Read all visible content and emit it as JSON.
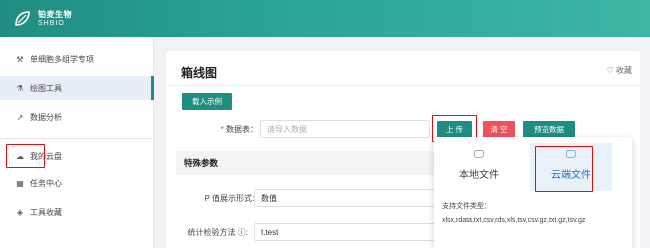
{
  "brand": {
    "name_cn": "铂麦生物",
    "name_en": "SHBIO"
  },
  "sidebar": {
    "items": [
      {
        "label": "单细胞多组学专项",
        "icon": "wrench-icon"
      },
      {
        "label": "绘图工具",
        "icon": "flask-icon"
      },
      {
        "label": "数据分析",
        "icon": "line-chart-icon"
      },
      {
        "label": "我的云盘",
        "icon": "cloud-icon"
      },
      {
        "label": "任务中心",
        "icon": "calendar-icon"
      },
      {
        "label": "工具收藏",
        "icon": "tag-icon"
      }
    ]
  },
  "page": {
    "title": "箱线图",
    "favorite_label": "收藏",
    "load_example_label": "载入示例",
    "data_table_label": "数据表：",
    "data_input_placeholder": "请导入数据",
    "upload_label": "上 传",
    "clear_label": "清 空",
    "preview_label": "预览数据",
    "section_title": "特殊参数",
    "p_display_label": "P 值展示形式：",
    "p_display_value": "数值",
    "stat_method_label": "统计检验方法",
    "stat_method_value": "t.test"
  },
  "upload_popover": {
    "local_label": "本地文件",
    "cloud_label": "云端文件",
    "types_title": "支持文件类型：",
    "types": "xlsx,rdata,txt,csv,rds,xls,tsv,csv.gz,txt.gz,tsv.gz"
  },
  "colors": {
    "accent": "#1f8e82",
    "danger": "#f0525b",
    "highlight": "#e01010",
    "selected": "#1f6fd0"
  }
}
